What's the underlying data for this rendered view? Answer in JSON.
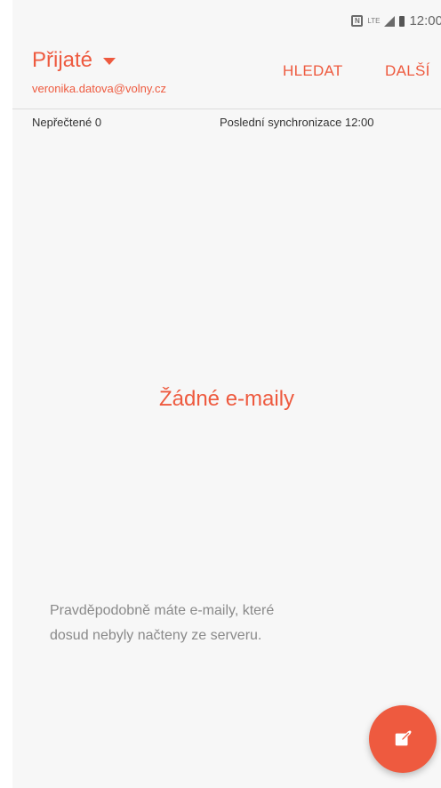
{
  "status_bar": {
    "lte_label": "LTE",
    "time": "12:00"
  },
  "header": {
    "folder_title": "Přijaté",
    "account": "veronika.datova@volny.cz",
    "search_label": "HLEDAT",
    "more_label": "DALŠÍ"
  },
  "info": {
    "unread": "Nepřečtené 0",
    "last_sync": "Poslední synchronizace 12:00"
  },
  "empty_state": {
    "title": "Žádné e-maily",
    "hint_line1": "Pravděpodobně máte e-maily, které",
    "hint_line2": "dosud nebyly načteny ze serveru."
  },
  "colors": {
    "accent": "#ee5a3f",
    "background": "#f7f7f7"
  },
  "icons": {
    "nfc": "nfc-icon",
    "signal": "signal-icon",
    "battery": "battery-icon",
    "caret": "caret-down-icon",
    "compose": "compose-icon"
  }
}
